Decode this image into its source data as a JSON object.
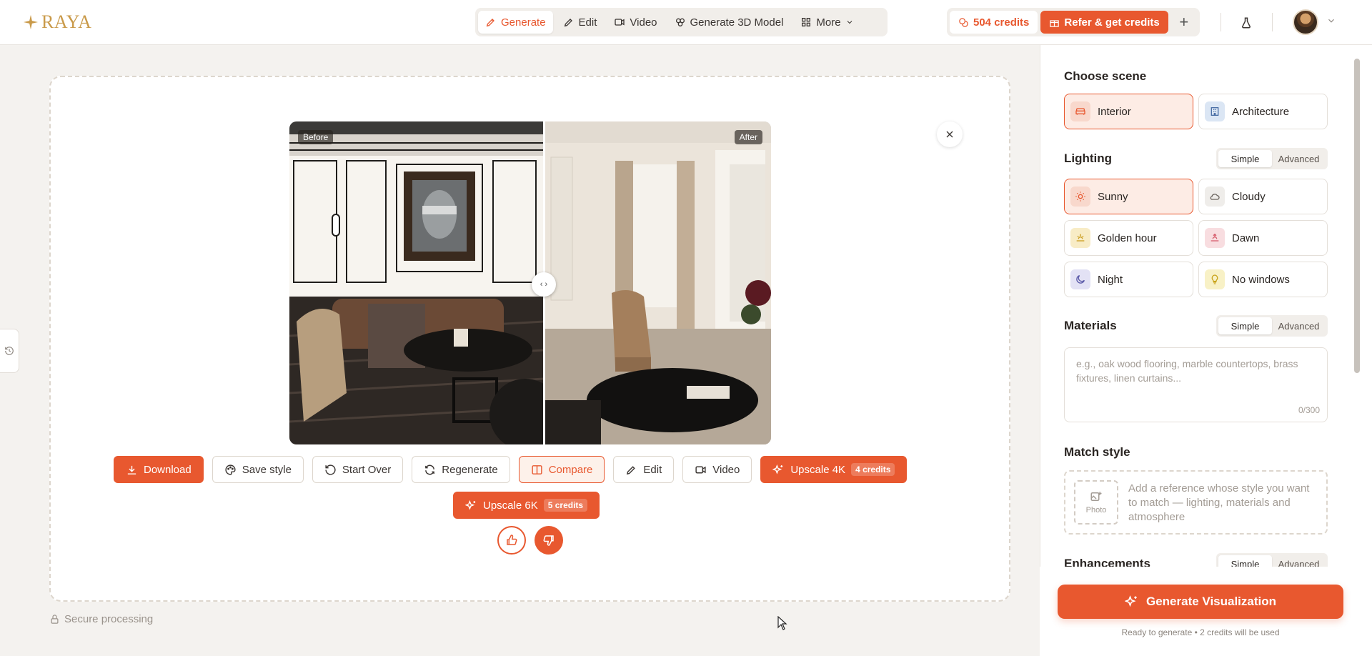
{
  "app": {
    "logo_text": "RAYA"
  },
  "nav": {
    "tabs": [
      {
        "label": "Generate",
        "icon": "pencil-spark-icon"
      },
      {
        "label": "Edit",
        "icon": "pencil-icon"
      },
      {
        "label": "Video",
        "icon": "video-icon"
      },
      {
        "label": "Generate 3D Model",
        "icon": "cube-icon"
      },
      {
        "label": "More",
        "icon": "grid-icon"
      }
    ],
    "active": "Generate"
  },
  "account": {
    "credits_label": "504 credits",
    "refer_label": "Refer & get credits"
  },
  "viewer": {
    "before_label": "Before",
    "after_label": "After"
  },
  "actions": {
    "download": "Download",
    "save_style": "Save style",
    "start_over": "Start Over",
    "regenerate": "Regenerate",
    "compare": "Compare",
    "edit": "Edit",
    "video": "Video",
    "upscale_4k": "Upscale 4K",
    "upscale_4k_cost": "4 credits",
    "upscale_6k": "Upscale 6K",
    "upscale_6k_cost": "5 credits"
  },
  "footer": {
    "secure": "Secure processing"
  },
  "panel": {
    "scene": {
      "title": "Choose scene",
      "options": [
        "Interior",
        "Architecture"
      ],
      "selected": "Interior"
    },
    "lighting": {
      "title": "Lighting",
      "modes": [
        "Simple",
        "Advanced"
      ],
      "mode_selected": "Simple",
      "options": [
        "Sunny",
        "Cloudy",
        "Golden hour",
        "Dawn",
        "Night",
        "No windows"
      ],
      "selected": "Sunny"
    },
    "materials": {
      "title": "Materials",
      "modes": [
        "Simple",
        "Advanced"
      ],
      "mode_selected": "Simple",
      "placeholder": "e.g., oak wood flooring, marble countertops, brass fixtures, linen curtains...",
      "counter": "0/300"
    },
    "match_style": {
      "title": "Match style",
      "photo_label": "Photo",
      "hint": "Add a reference whose style you want to match — lighting, materials and atmosphere"
    },
    "enhancements": {
      "title": "Enhancements",
      "modes": [
        "Simple",
        "Advanced"
      ],
      "mode_selected": "Simple"
    },
    "generate": {
      "label": "Generate Visualization",
      "note": "Ready to generate • 2 credits will be used"
    }
  },
  "colors": {
    "accent": "#e8582f",
    "brand_gold": "#c99a4a"
  }
}
